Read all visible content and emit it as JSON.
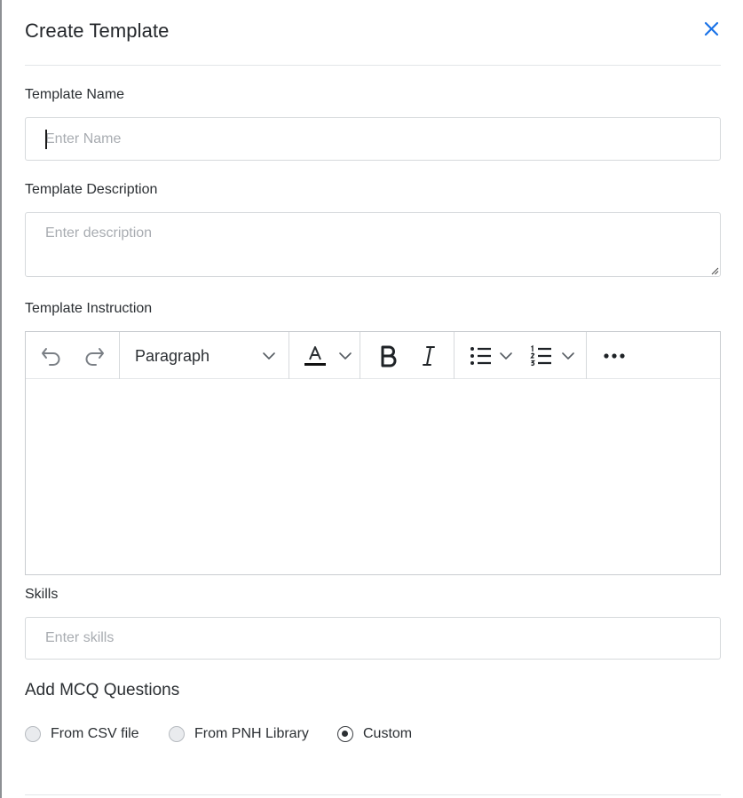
{
  "modal": {
    "title": "Create Template",
    "close_icon": "close-icon"
  },
  "template_name": {
    "label": "Template Name",
    "placeholder": "Enter Name",
    "value": ""
  },
  "template_description": {
    "label": "Template Description",
    "placeholder": "Enter description",
    "value": ""
  },
  "template_instruction": {
    "label": "Template Instruction",
    "toolbar": {
      "undo_icon": "undo-icon",
      "redo_icon": "redo-icon",
      "block_format": "Paragraph",
      "text_color_icon": "font-color-icon",
      "bold_icon": "bold-icon",
      "italic_icon": "italic-icon",
      "bullet_list_icon": "bulleted-list-icon",
      "numbered_list_icon": "numbered-list-icon",
      "more_icon": "more-options-icon"
    },
    "content": ""
  },
  "skills": {
    "label": "Skills",
    "placeholder": "Enter skills",
    "value": ""
  },
  "mcq": {
    "title": "Add MCQ Questions",
    "options": [
      {
        "label": "From CSV file",
        "selected": false
      },
      {
        "label": "From PNH Library",
        "selected": false
      },
      {
        "label": "Custom",
        "selected": true
      }
    ]
  },
  "colors": {
    "accent": "#1a73e8",
    "text": "#2b2f33",
    "placeholder": "#a8acb1",
    "border": "#d6d9dc"
  }
}
